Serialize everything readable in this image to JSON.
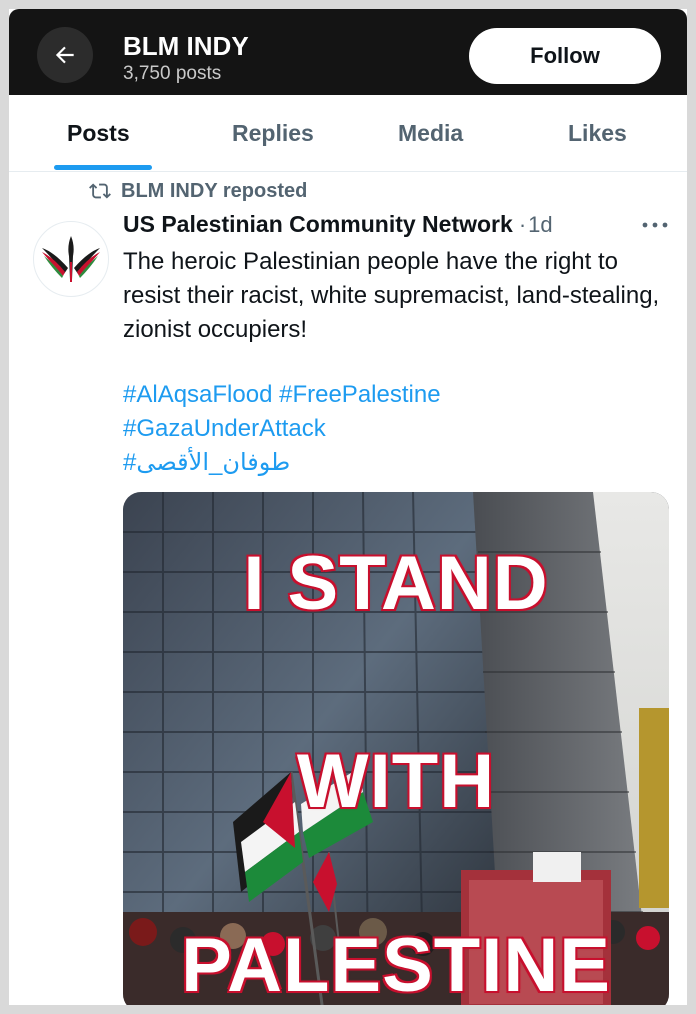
{
  "header": {
    "back_label": "Back",
    "title": "BLM INDY",
    "post_count": "3,750 posts",
    "follow_label": "Follow"
  },
  "tabs": [
    {
      "label": "Posts",
      "active": true
    },
    {
      "label": "Replies",
      "active": false
    },
    {
      "label": "Media",
      "active": false
    },
    {
      "label": "Likes",
      "active": false
    }
  ],
  "post": {
    "repost_text": "BLM INDY reposted",
    "author_name": "US Palestinian Community Network",
    "separator": "·",
    "time": "1d",
    "text": "The heroic Palestinian people have the right to resist their racist, white supremacist, land-stealing, zionist occupiers!",
    "hashtags": [
      "#AlAqsaFlood",
      "#FreePalestine",
      "#GazaUnderAttack",
      "#طوفان_الأقصى"
    ],
    "image_text": [
      "I STAND",
      "WITH",
      "PALESTINE"
    ]
  },
  "colors": {
    "accent": "#1d9bf0",
    "header_bg": "#141414",
    "overlay_stroke": "#c8102e"
  }
}
